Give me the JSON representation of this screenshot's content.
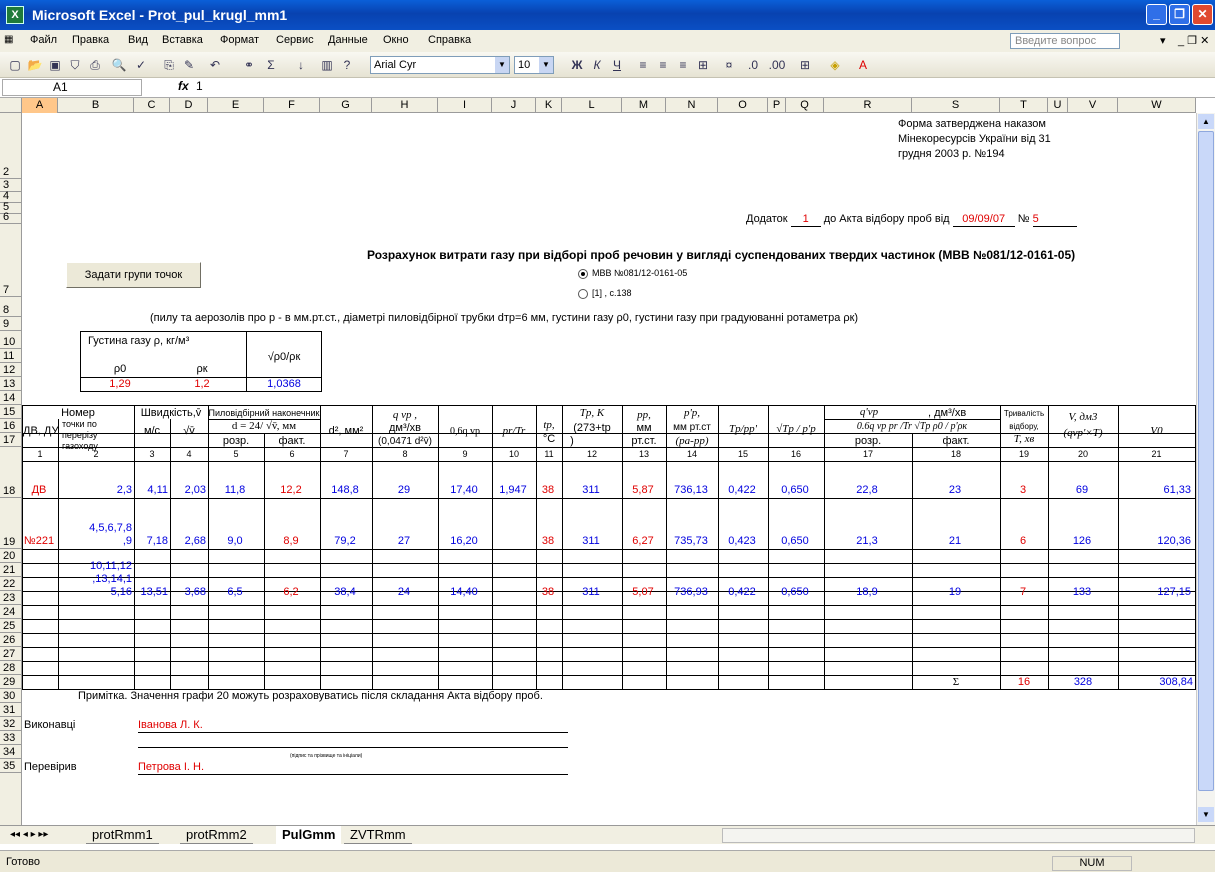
{
  "window": {
    "title": "Microsoft Excel - Prot_pul_krugl_mm1",
    "app_icon": "excel-icon",
    "buttons": [
      "_",
      "❐",
      "✕"
    ]
  },
  "menu": {
    "items": [
      "Файл",
      "Правка",
      "Вид",
      "Вставка",
      "Формат",
      "Сервис",
      "Данные",
      "Окно",
      "Справка"
    ],
    "help_placeholder": "Введите вопрос"
  },
  "toolbar": {
    "font": "Arial Cyr",
    "size": "10",
    "bold": "Ж",
    "italic": "К",
    "underline": "Ч"
  },
  "formula": {
    "cell": "A1",
    "fx": "fx",
    "value": "1"
  },
  "columns": [
    "A",
    "B",
    "C",
    "D",
    "E",
    "F",
    "G",
    "H",
    "I",
    "J",
    "K",
    "L",
    "M",
    "N",
    "O",
    "P",
    "Q",
    "R",
    "S",
    "T",
    "U",
    "V",
    "W"
  ],
  "rows": [
    "1",
    "2",
    "3",
    "4",
    "5",
    "6",
    "7",
    "8",
    "9",
    "10",
    "11",
    "12",
    "13",
    "14",
    "15",
    "16",
    "17",
    "18",
    "19",
    "20",
    "21",
    "22",
    "23",
    "24",
    "25",
    "26",
    "27",
    "28",
    "29",
    "30",
    "31",
    "32",
    "33",
    "34",
    "35"
  ],
  "form_note": [
    "Форма затверджена наказом",
    "Мінекоресурсів України від 31",
    "грудня 2003 р. №194"
  ],
  "dodatok": {
    "label": "Додаток",
    "num": "1",
    "to": "до Акта відбору проб від",
    "date": "09/09/07",
    "no_label": "№",
    "no": "5"
  },
  "heading": "Розрахунок витрати газу при відборі проб речовин у вигляді суспендованих твердих частинок  (МВВ №081/12-0161-05)",
  "button_groups": "Задати групи точок",
  "options": [
    "МВВ №081/12-0161-05",
    "[1] , с.138"
  ],
  "subtitle": "(пилу та аерозолів про p  - в мм.рт.ст., діаметрі пиловідбірної трубки dтр=6 мм, густини газу ρ0, густини газу при градуюванні ротаметра ρк)",
  "density": {
    "title": "Густина газу ρ, кг/м³",
    "h1": "ρ0",
    "h2": "ρк",
    "h3": "√ρ0/ρк",
    "v1": "1,29",
    "v2": "1,2",
    "v3": "1,0368"
  },
  "headers": {
    "nomer": "Номер",
    "dvdu": "ДВ, ДУ",
    "tochky": [
      "точки по",
      "перерізу",
      "газоходу"
    ],
    "shvydkist": "Швидкість,v̄",
    "ms": "м/с",
    "sqrtv": "√v̄",
    "nakon": "Пиловідбірний наконечник",
    "dform": "d = 24/ √v̄, мм",
    "rozr": "розр.",
    "fakt": "факт.",
    "d2": "d², мм²",
    "qvp": "q vp ,",
    "dm3": "дм³/хв",
    "qform": "(0,0471 d²v̄)",
    "q06": "0,6q vp",
    "prtr": "pr/Tr",
    "tp": "tp,",
    "tpc": "°C",
    "Tp": "Tp, K",
    "Tpf": "(273+tp",
    "Tpf2": ")",
    "pp": "pp,",
    "ppmm": "мм",
    "pprt": "рт.ст.",
    "pp2": "p'p,",
    "pp2mm": "мм рт.ст",
    "pp2f": "(pa-pp)",
    "tpp": "Tp/pp'",
    "sqrt": "√Tp / p'p",
    "qprime": "q'vp",
    "dm3x": ", дм³/хв",
    "qform2": "0.6q vp pr /Tr √Tp ρ0 / p'ρк",
    "rozr2": "розр.",
    "fakt2": "факт.",
    "tryv": "Тривалість",
    "vidb": "відбору,",
    "txv": "T, хв",
    "V": "V, дм3",
    "Vf": "(qvp'×T)",
    "V0": "V0"
  },
  "col_numbers": [
    "1",
    "2",
    "3",
    "4",
    "5",
    "6",
    "7",
    "8",
    "9",
    "10",
    "11",
    "12",
    "13",
    "14",
    "15",
    "16",
    "17",
    "18",
    "19",
    "20",
    "21"
  ],
  "data_rows": [
    {
      "c1": "ДВ",
      "c2": [
        "2,3"
      ],
      "c3": "4,11",
      "c4": "2,03",
      "c5": "11,8",
      "c6": "12,2",
      "c7": "148,8",
      "c8": "29",
      "c9": "17,40",
      "c10": "1,947",
      "c11": "38",
      "c12": "311",
      "c13": "5,87",
      "c14": "736,13",
      "c15": "0,422",
      "c16": "0,650",
      "c17": "22,8",
      "c18": "23",
      "c19": "3",
      "c20": "69",
      "c21": "61,33"
    },
    {
      "c1": "№221",
      "c2": [
        "4,5,6,7,8",
        ",9"
      ],
      "c3": "7,18",
      "c4": "2,68",
      "c5": "9,0",
      "c6": "8,9",
      "c7": "79,2",
      "c8": "27",
      "c9": "16,20",
      "c10": "",
      "c11": "38",
      "c12": "311",
      "c13": "6,27",
      "c14": "735,73",
      "c15": "0,423",
      "c16": "0,650",
      "c17": "21,3",
      "c18": "21",
      "c19": "6",
      "c20": "126",
      "c21": "120,36"
    },
    {
      "c1": "",
      "c2": [
        "10,11,12",
        ",13,14,1",
        "5,16"
      ],
      "c3": "13,51",
      "c4": "3,68",
      "c5": "6,5",
      "c6": "6,2",
      "c7": "38,4",
      "c8": "24",
      "c9": "14,40",
      "c10": "",
      "c11": "38",
      "c12": "311",
      "c13": "5,07",
      "c14": "736,93",
      "c15": "0,422",
      "c16": "0,650",
      "c17": "18,9",
      "c18": "19",
      "c19": "7",
      "c20": "133",
      "c21": "127,15"
    }
  ],
  "totals": {
    "sigma": "Σ",
    "t": "16",
    "v": "328",
    "v0": "308,84"
  },
  "note": "Примітка. Значення графи 20 можуть розраховуватись після складання Акта відбору проб.",
  "signatures": {
    "exec_label": "Виконавці",
    "exec_name": "Іванова Л. К.",
    "exec_hint": "(підпис та прізвище та ініціали)",
    "check_label": "Перевірив",
    "check_name": "Петрова І. Н."
  },
  "tabs": [
    "protRmm1",
    "protRmm2",
    "PulGmm",
    "ZVTRmm"
  ],
  "status": {
    "left": "Готово",
    "num": "NUM"
  }
}
